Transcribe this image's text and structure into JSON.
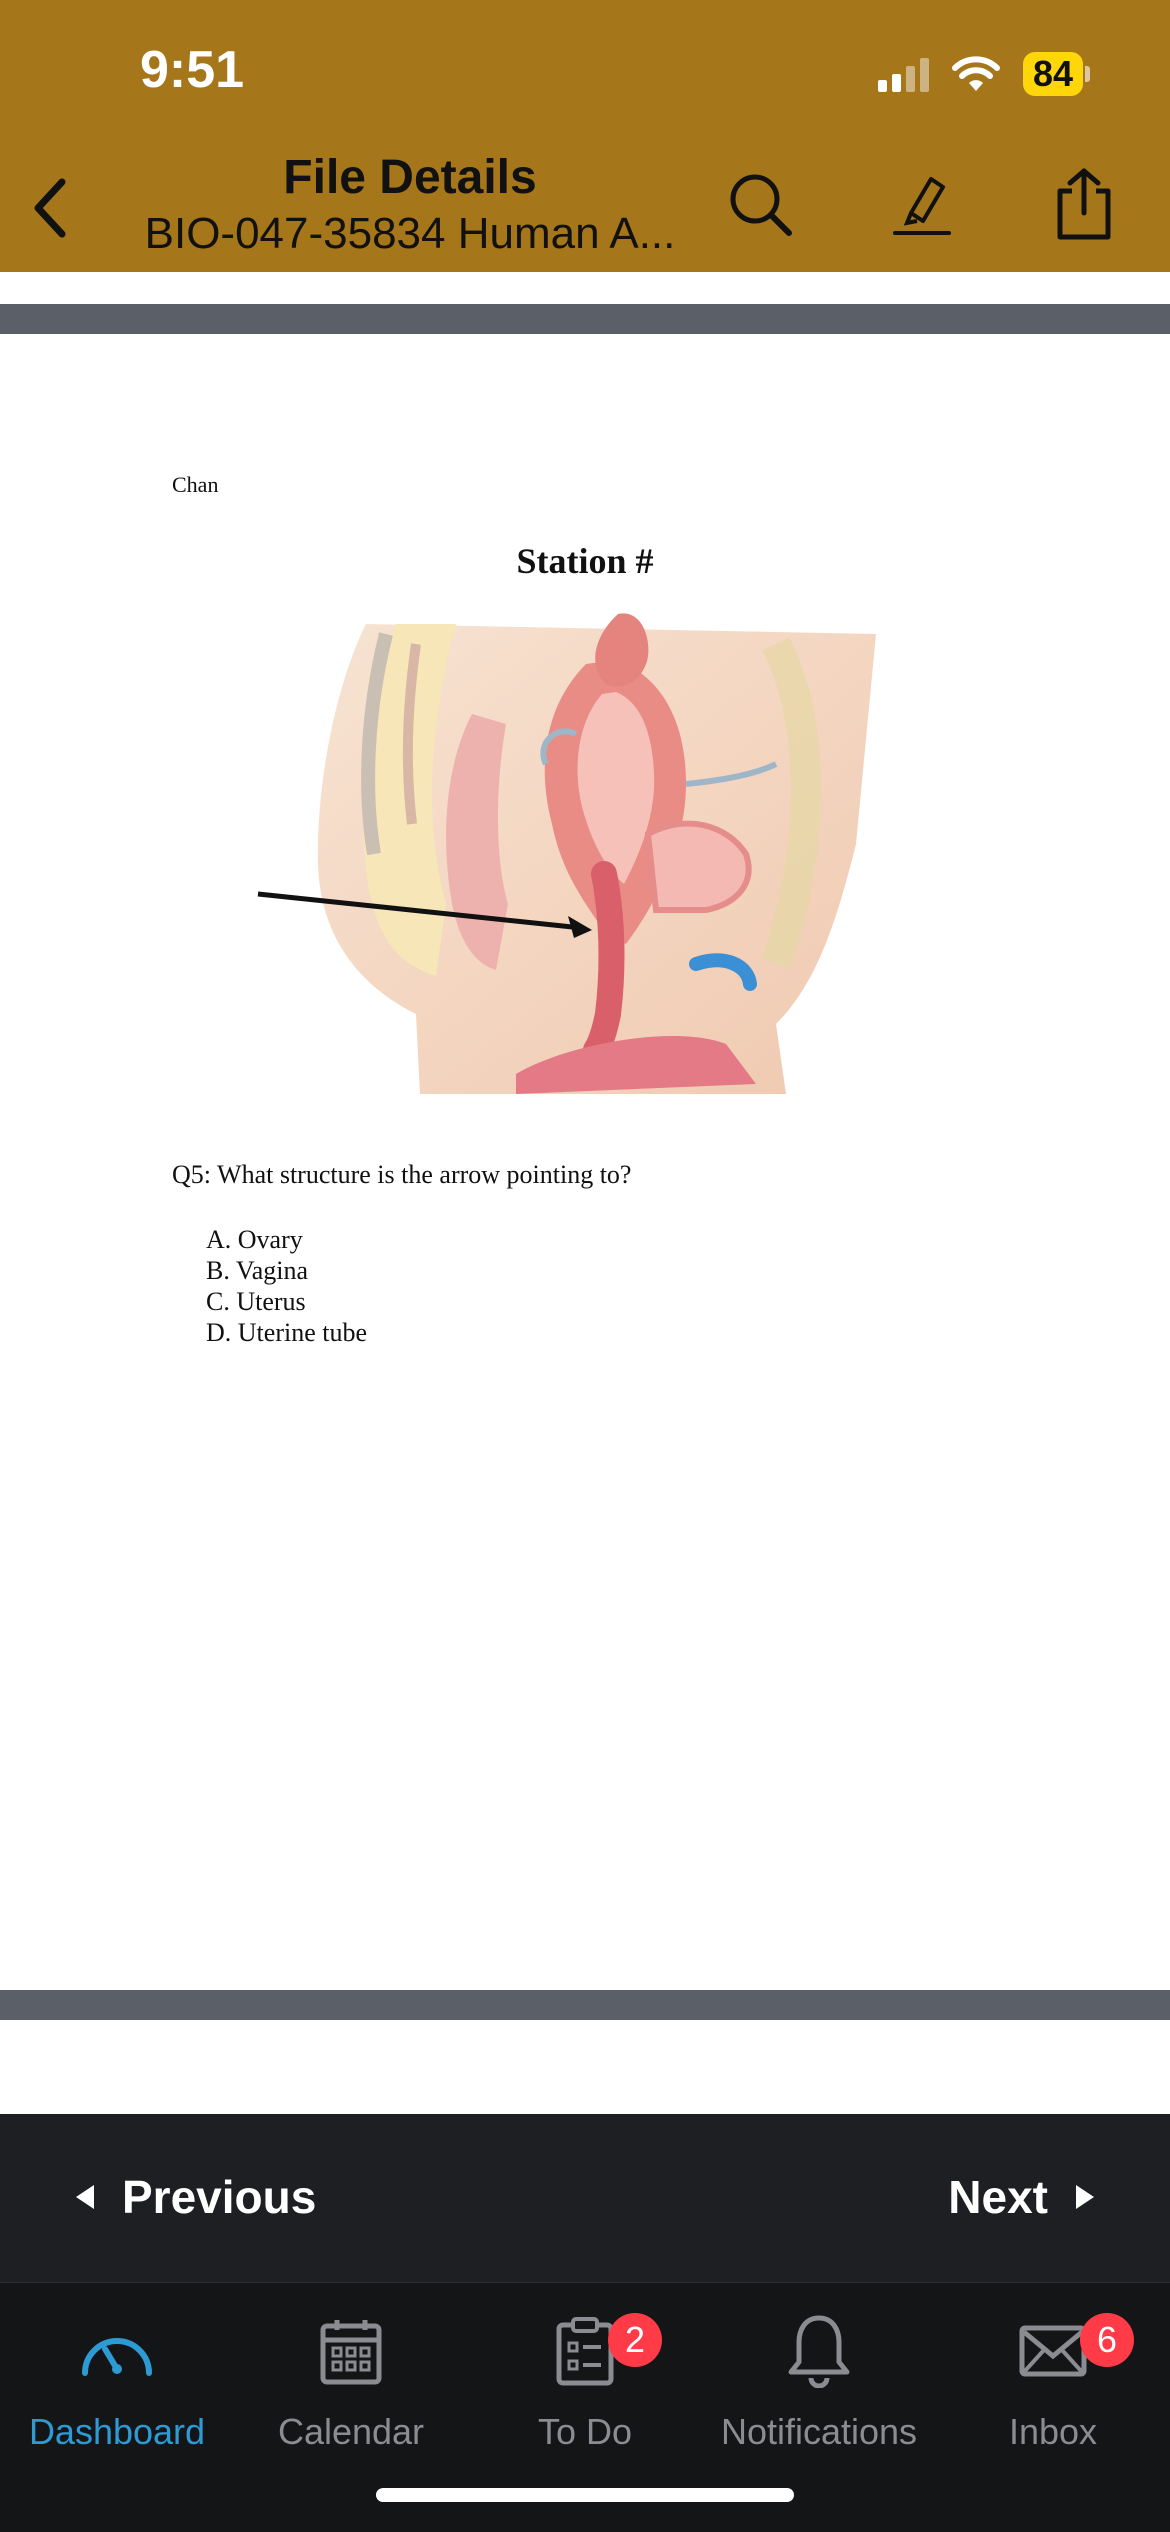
{
  "status_bar": {
    "time": "9:51",
    "battery": "84"
  },
  "header": {
    "title": "File Details",
    "subtitle": "BIO-047-35834 Human A..."
  },
  "document": {
    "name": "Chan",
    "heading": "Station #",
    "question": "Q5: What structure is the arrow pointing to?",
    "options": [
      "A. Ovary",
      "B. Vagina",
      "C. Uterus",
      "D. Uterine tube"
    ]
  },
  "pager": {
    "previous_label": "Previous",
    "next_label": "Next"
  },
  "tabs": [
    {
      "label": "Dashboard",
      "icon": "dashboard-icon",
      "active": true
    },
    {
      "label": "Calendar",
      "icon": "calendar-icon"
    },
    {
      "label": "To Do",
      "icon": "todo-icon",
      "badge": "2"
    },
    {
      "label": "Notifications",
      "icon": "bell-icon"
    },
    {
      "label": "Inbox",
      "icon": "inbox-icon",
      "badge": "6"
    }
  ],
  "colors": {
    "header": "#a5761a",
    "accent": "#2d9ad3",
    "badge": "#ff3b47",
    "battery": "#ffd60a"
  }
}
